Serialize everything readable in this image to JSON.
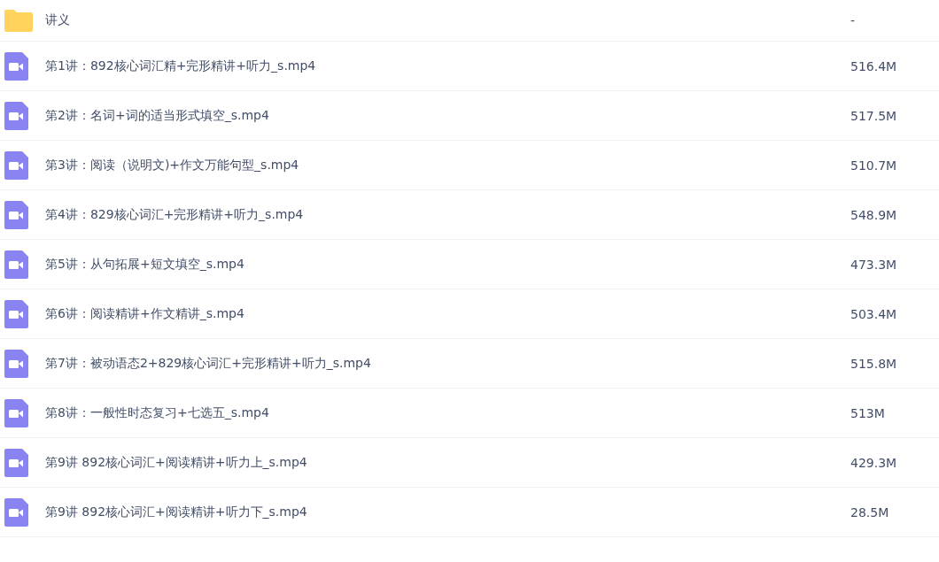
{
  "files": [
    {
      "kind": "folder",
      "name": "讲义",
      "size": "-"
    },
    {
      "kind": "video",
      "name": "第1讲：892核心词汇精+完形精讲+听力_s.mp4",
      "size": "516.4M"
    },
    {
      "kind": "video",
      "name": "第2讲：名词+词的适当形式填空_s.mp4",
      "size": "517.5M"
    },
    {
      "kind": "video",
      "name": "第3讲：阅读（说明文)+作文万能句型_s.mp4",
      "size": "510.7M"
    },
    {
      "kind": "video",
      "name": "第4讲：829核心词汇+完形精讲+听力_s.mp4",
      "size": "548.9M"
    },
    {
      "kind": "video",
      "name": "第5讲：从句拓展+短文填空_s.mp4",
      "size": "473.3M"
    },
    {
      "kind": "video",
      "name": "第6讲：阅读精讲+作文精讲_s.mp4",
      "size": "503.4M"
    },
    {
      "kind": "video",
      "name": "第7讲：被动语态2+829核心词汇+完形精讲+听力_s.mp4",
      "size": "515.8M"
    },
    {
      "kind": "video",
      "name": "第8讲：一般性时态复习+七选五_s.mp4",
      "size": "513M"
    },
    {
      "kind": "video",
      "name": "第9讲 892核心词汇+阅读精讲+听力上_s.mp4",
      "size": "429.3M"
    },
    {
      "kind": "video",
      "name": "第9讲 892核心词汇+阅读精讲+听力下_s.mp4",
      "size": "28.5M"
    }
  ]
}
